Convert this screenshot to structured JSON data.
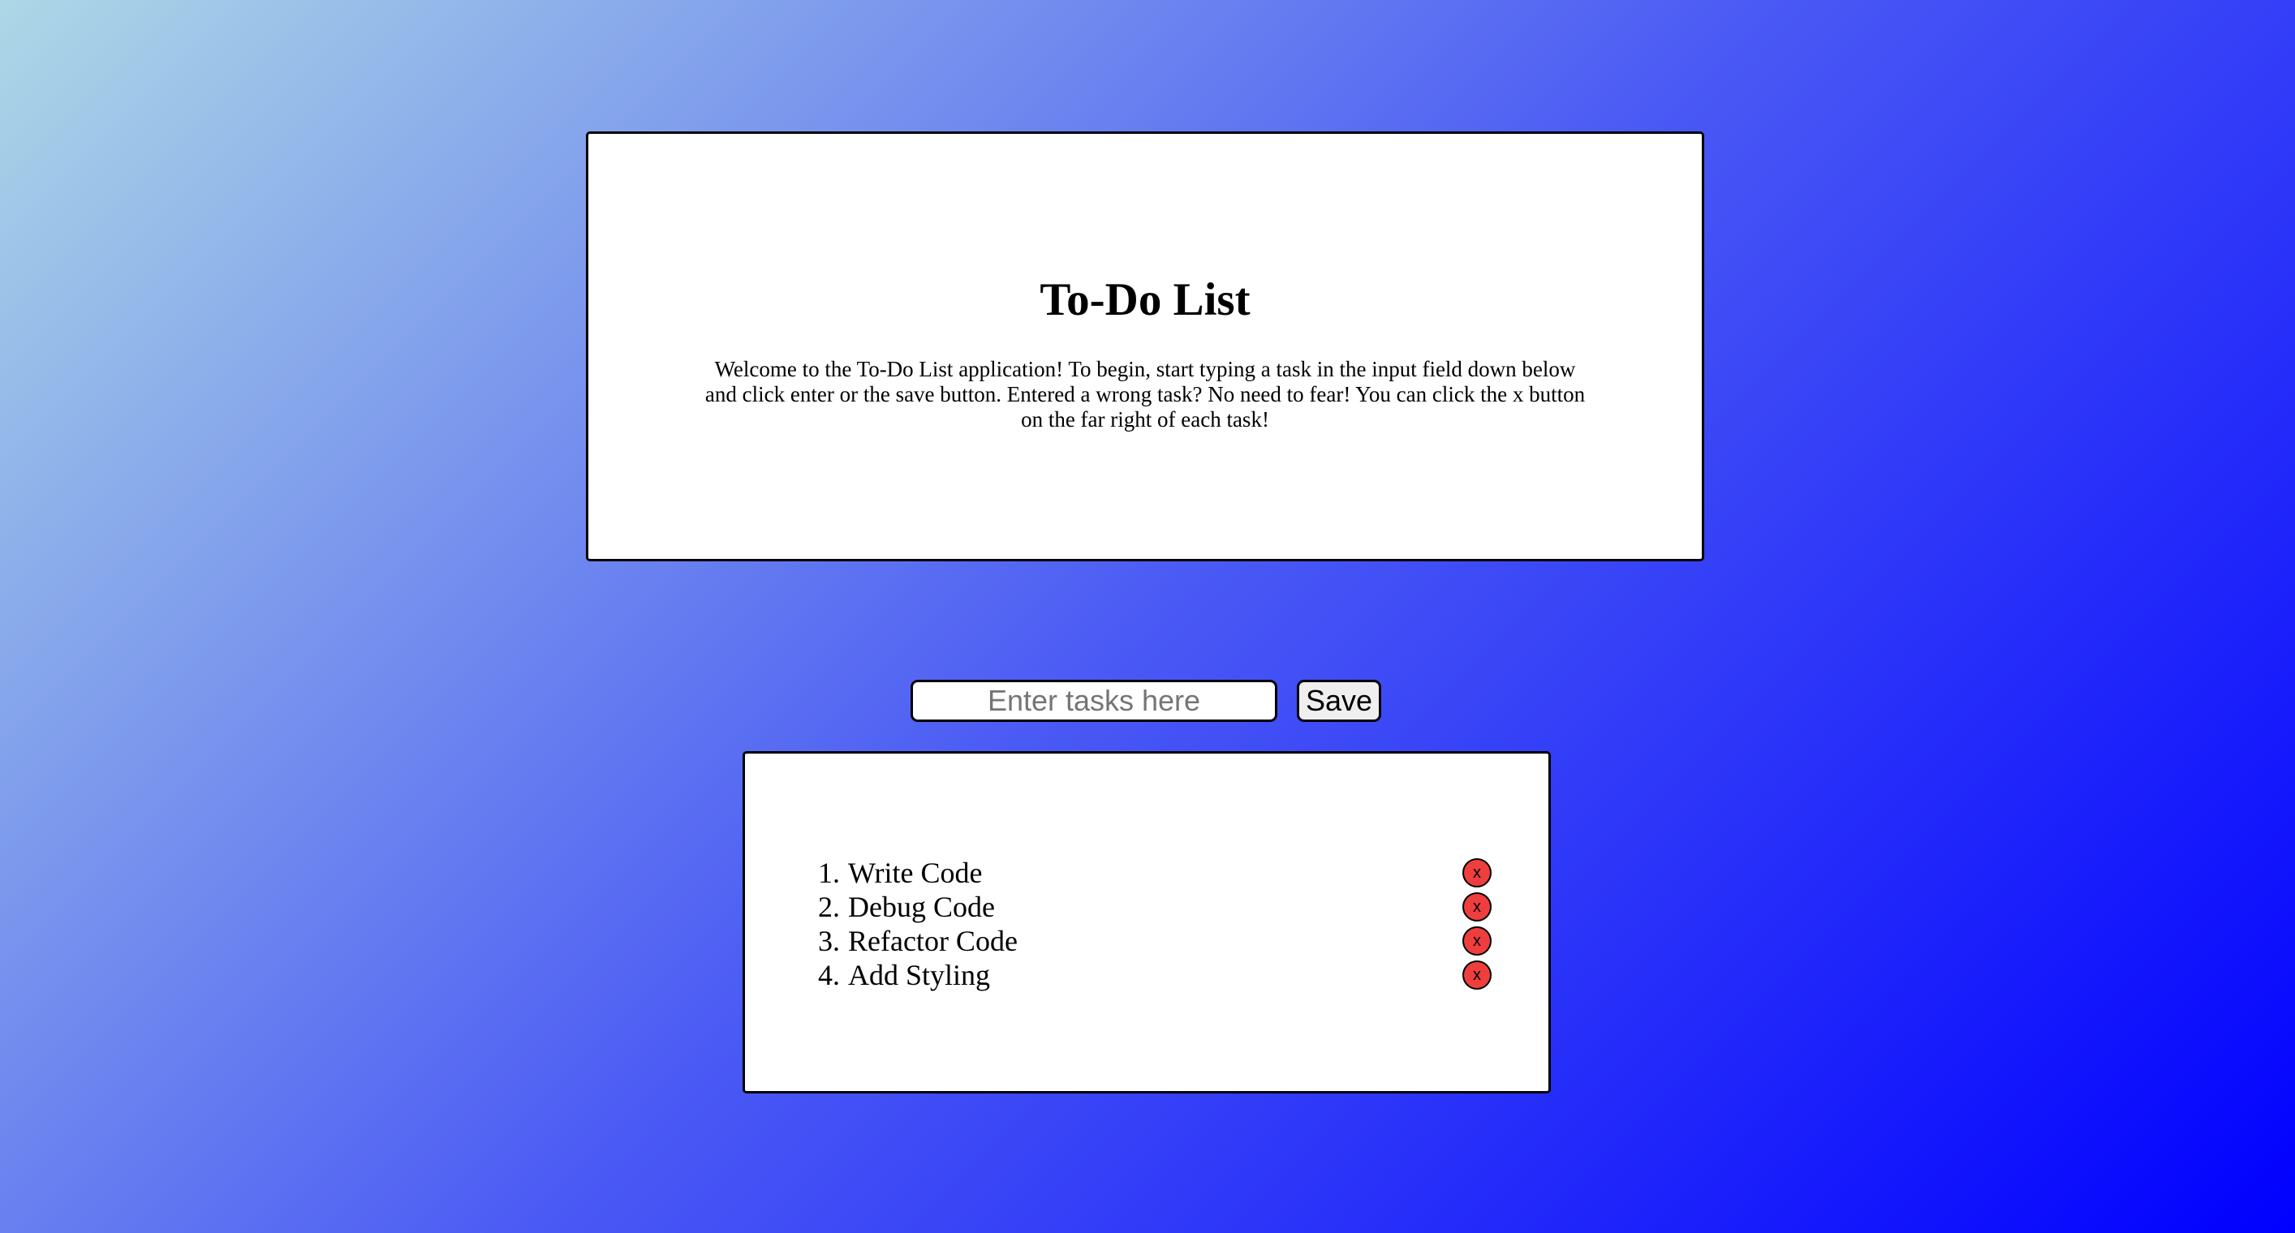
{
  "intro": {
    "title": "To-Do List",
    "description": "Welcome to the To-Do List application! To begin, start typing a task in the input field down below and click enter or the save button. Entered a wrong task? No need to fear! You can click the x button on the far right of each task!"
  },
  "form": {
    "placeholder": "Enter tasks here",
    "value": "",
    "save_label": "Save"
  },
  "tasks": [
    {
      "number": "1.",
      "label": "Write Code",
      "delete_label": "x"
    },
    {
      "number": "2.",
      "label": "Debug Code",
      "delete_label": "x"
    },
    {
      "number": "3.",
      "label": "Refactor Code",
      "delete_label": "x"
    },
    {
      "number": "4.",
      "label": "Add Styling",
      "delete_label": "x"
    }
  ],
  "colors": {
    "gradient_start": "#add8e6",
    "gradient_end": "#0000ff",
    "delete_button": "#ef3e3e",
    "card_background": "#ffffff"
  }
}
